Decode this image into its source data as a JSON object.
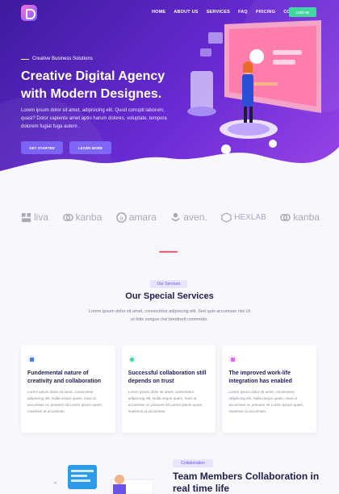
{
  "nav": {
    "items": [
      "HOME",
      "ABOUT US",
      "SERVICES",
      "FAQ",
      "PRICING",
      "CONTACT"
    ],
    "login": "LOG IN"
  },
  "hero": {
    "eyebrow": "Creative Business Solutions",
    "title": "Creative Digital Agency with Modern Designes.",
    "text": "Lorem ipsum dolor sit amet, adipisicing elit. Quod corrupti laborum, quasi? Dolor sapiente amet aptio harum dolores, voluptate, tempora dolorem fugiat fuga autem .",
    "primary_button": "GET STARTED",
    "secondary_button": "LEARN MORE"
  },
  "brands": [
    "liva",
    "kanba",
    "amara",
    "aven.",
    "HEXLAB",
    "kanba"
  ],
  "services": {
    "badge": "Our Services",
    "title": "Our Special Services",
    "subtitle": "Lorem ipsum dolor sit amet, consectetur adipiscing elit. Sed quis accumsan nisi Ut ut felis congue nisl hendrerit commodo.",
    "cards": [
      {
        "title": "Fundemental nature of creativity and collaboration",
        "text": "Lorem ipsum dolor sit amet, consectetur adipiscing elit. Nulla neque quam, maxi ut accumsan ut, posuere sit Lorem ipsum quam, maximus ut accumsan."
      },
      {
        "title": "Successful collaboration still depends on trust",
        "text": "Lorem ipsum dolor sit amet, consectetur adipiscing elit. Nulla neque quam, maxi ut accumsan ut, posuere sit Lorem ipsum quam, maximus ut accumsan."
      },
      {
        "title": "The improved work-life integration has enabled",
        "text": "Lorem ipsum dolor sit amet, consectetur adipiscing elit. Nulla neque quam, maxi ut accumsan ut, posuere sit Lorem ipsum quam, maximus ut accumsan."
      }
    ]
  },
  "collaboration": {
    "badge": "Collaboration",
    "title": "Team Members Collaboration in real time life"
  },
  "colors": {
    "hero_start": "#3d1a9e",
    "hero_end": "#9b45e8",
    "login": "#3fd6a0",
    "accent": "#6c52e6",
    "divider": "#f45b6a"
  },
  "icons": [
    "logo-icon",
    "liva-logo-icon",
    "kanba-logo-icon",
    "amara-logo-icon",
    "aven-logo-icon",
    "hexlab-logo-icon",
    "file-icon",
    "check-icon",
    "edit-icon"
  ]
}
